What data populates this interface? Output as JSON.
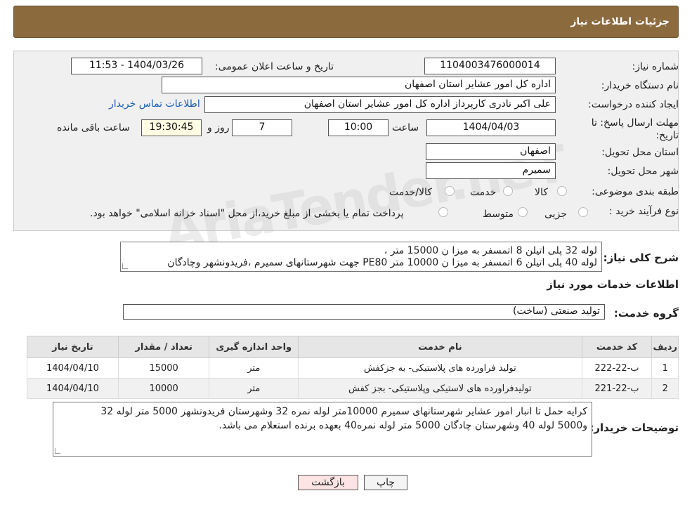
{
  "header": {
    "title": "جزئیات اطلاعات نیاز"
  },
  "fields": {
    "need_number_label": "شماره نیاز:",
    "need_number": "1104003476000014",
    "announce_label": "تاریخ و ساعت اعلان عمومی:",
    "announce_value": "1404/03/26 - 11:53",
    "buyer_org_label": "نام دستگاه خریدار:",
    "buyer_org": "اداره کل امور عشایر استان اصفهان",
    "creator_label": "ایجاد کننده درخواست:",
    "creator": "علی اکبر نادری کارپرداز اداره کل امور عشایر استان اصفهان",
    "contact_link": "اطلاعات تماس خریدار",
    "deadline_label": "مهلت ارسال پاسخ: تا تاریخ:",
    "deadline_date": "1404/04/03",
    "time_label": "ساعت",
    "deadline_time": "10:00",
    "days_value": "7",
    "days_label": "روز و",
    "remaining_time": "19:30:45",
    "remaining_label": "ساعت باقی مانده",
    "province_label": "استان محل تحویل:",
    "province": "اصفهان",
    "city_label": "شهر محل تحویل:",
    "city": "سمیرم",
    "category_label": "طبقه بندی موضوعی:",
    "category_options": [
      "کالا",
      "خدمت",
      "کالا/خدمت"
    ],
    "process_label": "نوع فرآیند خرید :",
    "process_options": [
      "جزیی",
      "متوسط"
    ],
    "process_note": "پرداخت تمام یا بخشی از مبلغ خرید،از محل \"اسناد خزانه اسلامی\" خواهد بود."
  },
  "summary": {
    "label": "شرح کلی نیاز:",
    "line1": "لوله 32 پلی اتیلن 8 اتمسفر به میزا ن  15000 متر ،",
    "line2": "لوله 40 پلی اتیلن 6  اتمسفر  به میزا ن  10000 متر PE80  جهت شهرستانهای سمیرم ،فریدونشهر وچادگان"
  },
  "services": {
    "section_title": "اطلاعات خدمات مورد نیاز",
    "group_label": "گروه خدمت:",
    "group_value": "تولید صنعتی (ساخت)",
    "columns": [
      "ردیف",
      "کد خدمت",
      "نام خدمت",
      "واحد اندازه گیری",
      "تعداد / مقدار",
      "تاریخ نیاز"
    ],
    "rows": [
      [
        "1",
        "ب-22-222",
        "تولید فراورده های پلاستیکی- به جزکفش",
        "متر",
        "15000",
        "1404/04/10"
      ],
      [
        "2",
        "ب-22-221",
        "تولیدفراورده های لاستیکی وپلاستیکی- بجز کفش",
        "متر",
        "10000",
        "1404/04/10"
      ]
    ]
  },
  "buyer_notes": {
    "label": "توضیحات خریدار:",
    "line1": "کرایه حمل تا انبار امور عشایر شهرستانهای  سمیرم 10000متر لوله نمره 32 وشهرستان فریدونشهر 5000 متر لوله 32",
    "line2": "و5000 لوله 40 وشهرستان چادگان 5000 متر لوله نمره40 بعهده برنده استعلام می باشد."
  },
  "buttons": {
    "print": "چاپ",
    "back": "بازگشت"
  },
  "watermark": "AriaTender.neT",
  "colors": {
    "header_bg": "#8B6A3E",
    "link": "#1a5fb4",
    "remaining_bg": "#fffde3",
    "back_bg": "#fde4e4"
  }
}
